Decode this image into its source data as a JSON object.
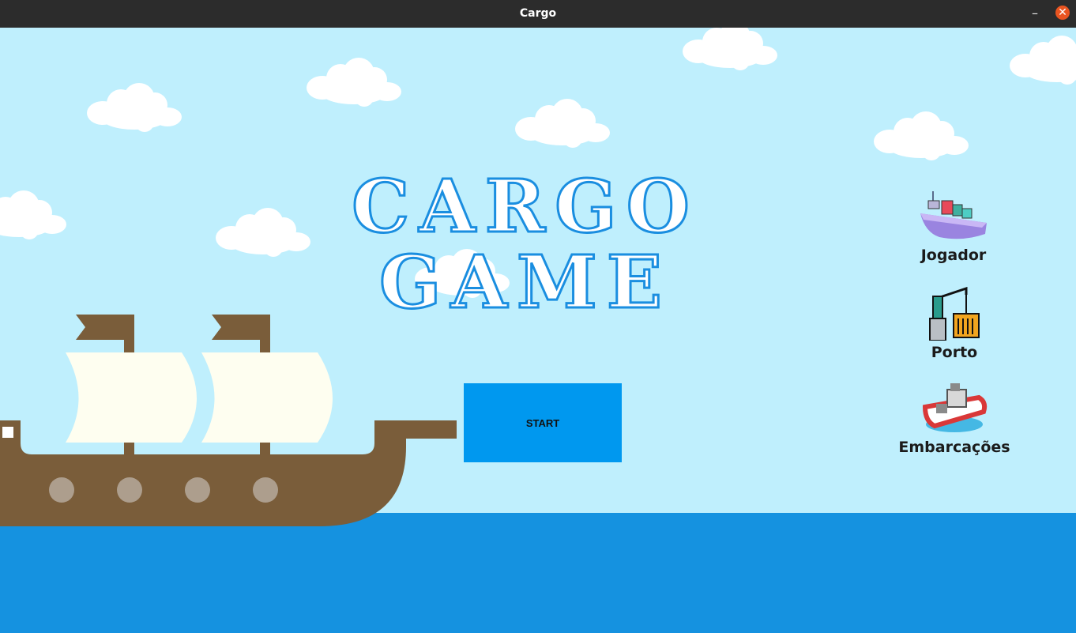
{
  "window": {
    "title": "Cargo",
    "minimize_glyph": "–",
    "close_glyph": "✕"
  },
  "game": {
    "title_line1": "CARGO",
    "title_line2": "GAME",
    "start_label": "START"
  },
  "menu": [
    {
      "label": "Jogador",
      "icon": "cargo-ship-icon"
    },
    {
      "label": "Porto",
      "icon": "port-crane-icon"
    },
    {
      "label": "Embarcações",
      "icon": "tugboat-icon"
    }
  ],
  "colors": {
    "sky": "#bfeffd",
    "sea": "#1592e0",
    "start_button": "#0098ef",
    "title_stroke": "#1a8ee0",
    "hull": "#7a5d3a",
    "sail": "#fefef0",
    "porthole": "#ad9e8d"
  }
}
